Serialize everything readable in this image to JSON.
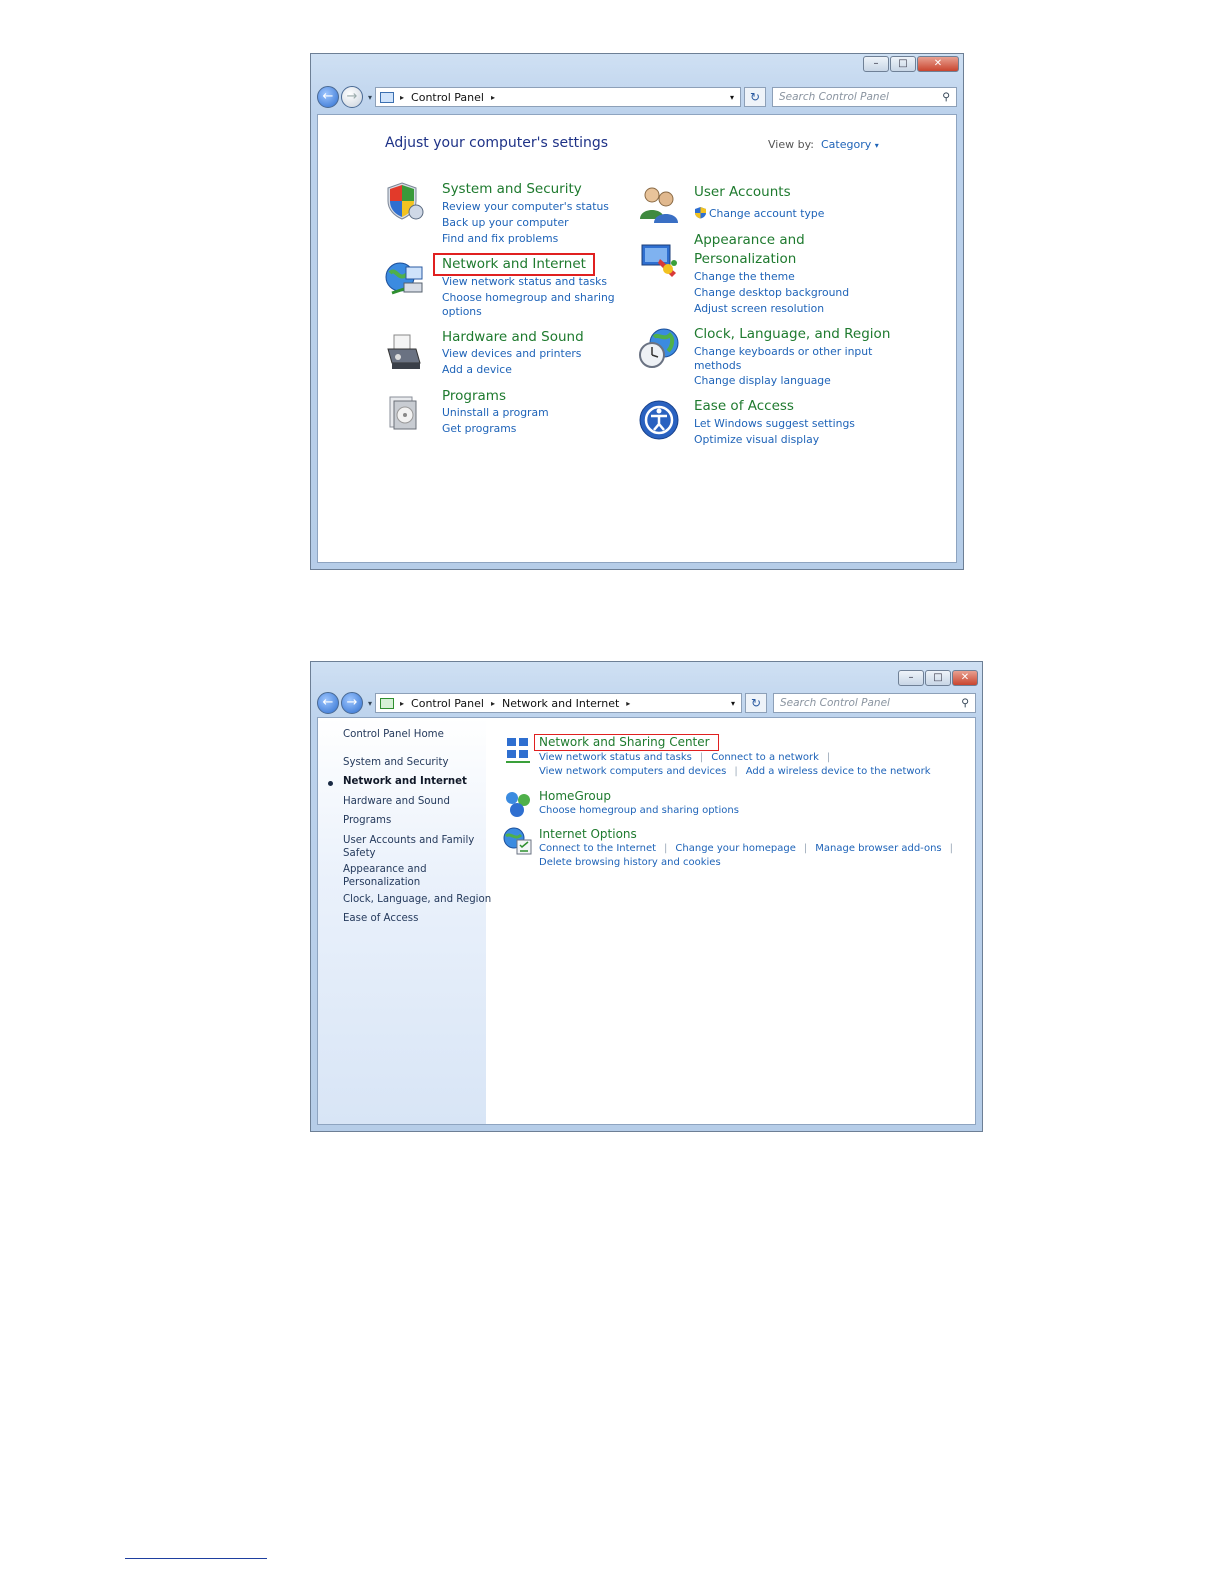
{
  "window1": {
    "address": [
      "Control Panel"
    ],
    "search_placeholder": "Search Control Panel",
    "heading": "Adjust your computer's settings",
    "view_by_label": "View by:",
    "view_by_value": "Category",
    "categories": [
      {
        "title": "System and Security",
        "links": [
          "Review your computer's status",
          "Back up your computer",
          "Find and fix problems"
        ]
      },
      {
        "title": "Network and Internet",
        "links": [
          "View network status and tasks",
          "Choose homegroup and sharing",
          "options"
        ]
      },
      {
        "title": "Hardware and Sound",
        "links": [
          "View devices and printers",
          "Add a device"
        ]
      },
      {
        "title": "Programs",
        "links": [
          "Uninstall a program",
          "Get programs"
        ]
      },
      {
        "title": "User Accounts",
        "links": [
          "Change account type"
        ]
      },
      {
        "title_lines": [
          "Appearance and",
          "Personalization"
        ],
        "links": [
          "Change the theme",
          "Change desktop background",
          "Adjust screen resolution"
        ]
      },
      {
        "title": "Clock, Language, and Region",
        "links": [
          "Change keyboards or other input",
          "methods",
          "Change display language"
        ]
      },
      {
        "title": "Ease of Access",
        "links": [
          "Let Windows suggest settings",
          "Optimize visual display"
        ]
      }
    ]
  },
  "window2": {
    "address": [
      "Control Panel",
      "Network and Internet"
    ],
    "search_placeholder": "Search Control Panel",
    "sidebar": {
      "home": "Control Panel Home",
      "items": [
        "System and Security",
        "Network and Internet",
        "Hardware and Sound",
        "Programs",
        "User Accounts and Family",
        "Safety",
        "Appearance and",
        "Personalization",
        "Clock, Language, and Region",
        "Ease of Access"
      ]
    },
    "sections": [
      {
        "title": "Network and Sharing Center",
        "row1": [
          "View network status and tasks",
          "Connect to a network"
        ],
        "row2": [
          "View network computers and devices",
          "Add a wireless device to the network"
        ]
      },
      {
        "title": "HomeGroup",
        "row1": [
          "Choose homegroup and sharing options"
        ]
      },
      {
        "title": "Internet Options",
        "row1": [
          "Connect to the Internet",
          "Change your homepage",
          "Manage browser add-ons"
        ],
        "row2": [
          "Delete browsing history and cookies"
        ]
      }
    ]
  },
  "icons": {
    "back": "←",
    "forward": "→",
    "dropdown": "▾",
    "breadcrumb_sep": "▸",
    "refresh": "↻",
    "search": "⚲",
    "minimize": "–",
    "maximize": "□",
    "close": "✕"
  },
  "colors": {
    "title_green": "#1e7a2e",
    "link_blue": "#1e63b8",
    "highlight_red": "#e02020"
  }
}
